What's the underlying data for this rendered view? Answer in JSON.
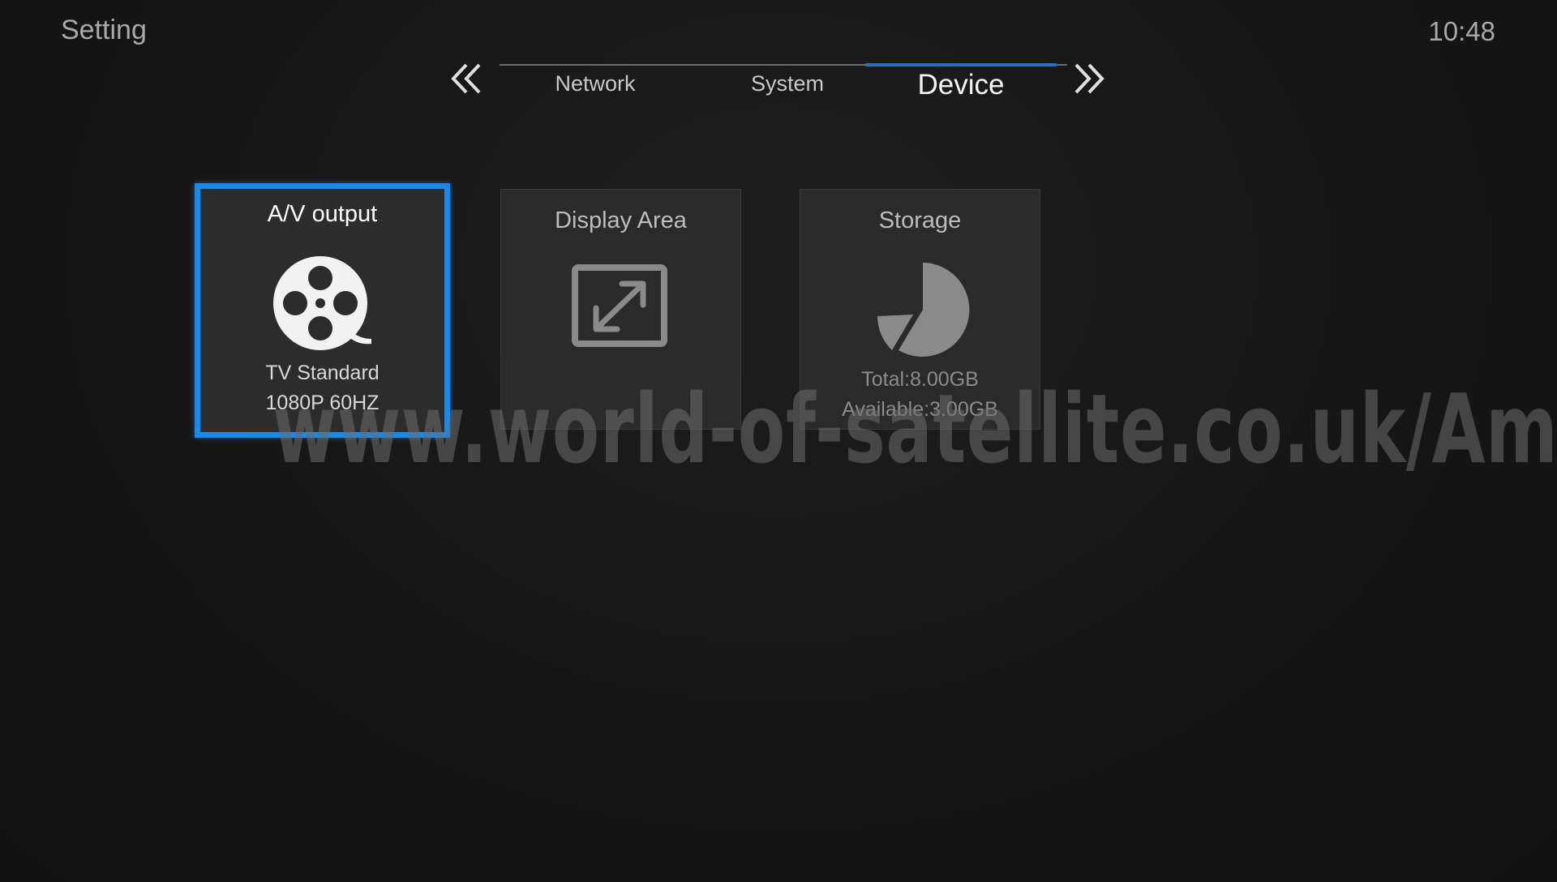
{
  "header": {
    "title": "Setting",
    "clock": "10:48"
  },
  "tabs": {
    "items": [
      {
        "label": "Network"
      },
      {
        "label": "System"
      },
      {
        "label": "Device"
      }
    ],
    "active": "Device",
    "prev_icon": "double-chevron-left-icon",
    "next_icon": "double-chevron-right-icon"
  },
  "cards": [
    {
      "title": "A/V output",
      "icon": "film-reel-icon",
      "line1": "TV Standard",
      "line2": "1080P 60HZ",
      "selected": true
    },
    {
      "title": "Display Area",
      "icon": "expand-arrows-icon",
      "line1": "",
      "line2": "",
      "selected": false
    },
    {
      "title": "Storage",
      "icon": "pie-chart-icon",
      "line1": "Total:8.00GB",
      "line2": "Available:3.00GB",
      "selected": false
    }
  ],
  "watermark": "www.world-of-satellite.co.uk/Amiko",
  "colors": {
    "accent": "#1e88e5",
    "tab_underline": "#2a6fc4",
    "background": "#161616"
  }
}
